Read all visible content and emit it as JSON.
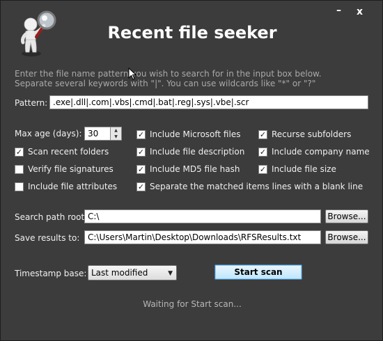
{
  "window": {
    "title": "Recent file seeker",
    "minimize_label": "–",
    "close_label": "x"
  },
  "instructions": {
    "line1": "Enter the file name pattern you wish to search for in the input box below.",
    "line2": "Separate several keywords with \"|\". You can use wildcards like \"*\" or \"?\""
  },
  "pattern": {
    "label": "Pattern:",
    "value": ".exe|.dll|.com|.vbs|.cmd|.bat|.reg|.sys|.vbe|.scr"
  },
  "max_age": {
    "label": "Max age (days):",
    "value": "30"
  },
  "options": [
    {
      "label": "Scan recent folders",
      "checked": true
    },
    {
      "label": "Verify file signatures",
      "checked": false
    },
    {
      "label": "Include file attributes",
      "checked": false
    },
    {
      "label": "Include Microsoft files",
      "checked": true
    },
    {
      "label": "Include file description",
      "checked": true
    },
    {
      "label": "Include MD5 file hash",
      "checked": true
    },
    {
      "label": "Separate the matched items lines with a blank line",
      "checked": true
    },
    {
      "label": "Recurse subfolders",
      "checked": true
    },
    {
      "label": "Include company name",
      "checked": true
    },
    {
      "label": "Include file size",
      "checked": true
    }
  ],
  "search_path": {
    "label": "Search path root:",
    "value": "C:\\",
    "browse_label": "Browse..."
  },
  "save_results": {
    "label": "Save results to:",
    "value": "C:\\Users\\Martin\\Desktop\\Downloads\\RFSResults.txt",
    "browse_label": "Browse..."
  },
  "timestamp": {
    "label": "Timestamp base:",
    "selected": "Last modified"
  },
  "start_button_label": "Start scan",
  "status_text": "Waiting for Start scan...",
  "colors": {
    "background": "#3c3c3c",
    "text": "#f0f0f0",
    "hint_text": "#a9a9a9",
    "primary_button_border": "#3c7fb1"
  }
}
